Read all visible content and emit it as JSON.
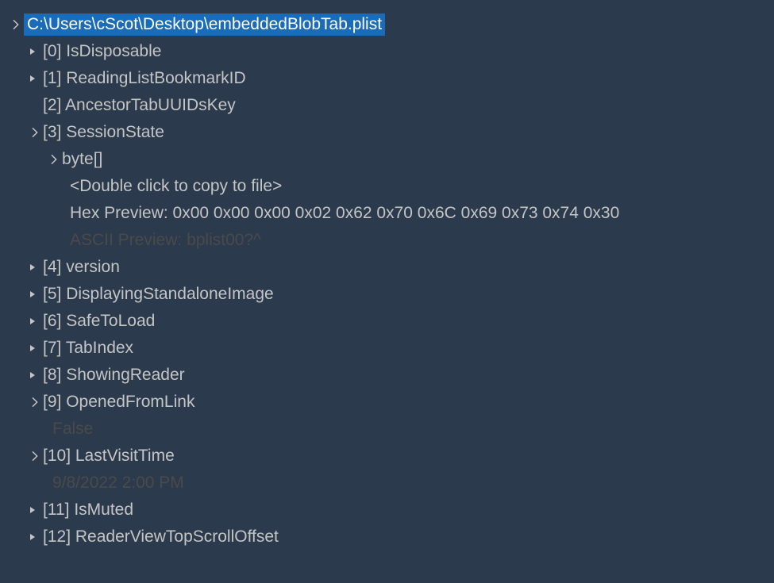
{
  "root": {
    "path": "C:\\Users\\cScot\\Desktop\\embeddedBlobTab.plist"
  },
  "items": [
    {
      "index": "[0]",
      "key": "IsDisposable"
    },
    {
      "index": "[1]",
      "key": "ReadingListBookmarkID"
    },
    {
      "index": "[2]",
      "key": "AncestorTabUUIDsKey"
    },
    {
      "index": "[3]",
      "key": "SessionState"
    },
    {
      "index": "[4]",
      "key": "version"
    },
    {
      "index": "[5]",
      "key": "DisplayingStandaloneImage"
    },
    {
      "index": "[6]",
      "key": "SafeToLoad"
    },
    {
      "index": "[7]",
      "key": "TabIndex"
    },
    {
      "index": "[8]",
      "key": "ShowingReader"
    },
    {
      "index": "[9]",
      "key": "OpenedFromLink"
    },
    {
      "index": "[10]",
      "key": "LastVisitTime"
    },
    {
      "index": "[11]",
      "key": "IsMuted"
    },
    {
      "index": "[12]",
      "key": "ReaderViewTopScrollOffset"
    }
  ],
  "sessionState": {
    "byteLabel": "byte[]",
    "copyHint": "<Double click to copy to file>",
    "hexPreviewLabel": "Hex Preview:",
    "hexPreviewValue": "0x00 0x00 0x00 0x02 0x62 0x70 0x6C 0x69 0x73 0x74 0x30",
    "asciiPreviewLabel": "ASCII Preview:",
    "asciiPreviewValue": "bplist00?^"
  },
  "values": {
    "openedFromLink": "False",
    "lastVisitTime": "9/8/2022 2:00 PM"
  }
}
